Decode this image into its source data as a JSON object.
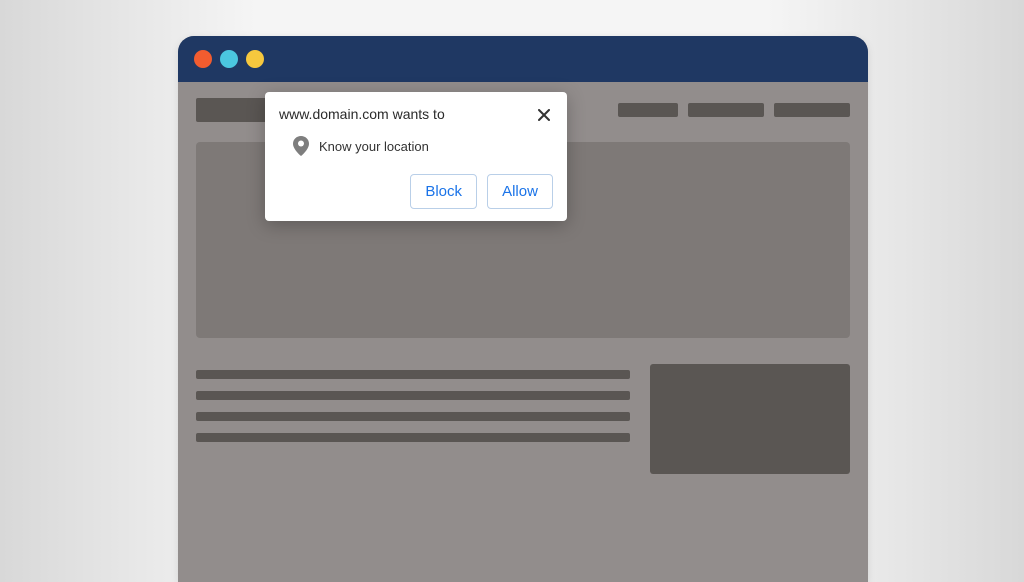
{
  "popup": {
    "title": "www.domain.com wants to",
    "request": "Know your location",
    "block": "Block",
    "allow": "Allow"
  }
}
